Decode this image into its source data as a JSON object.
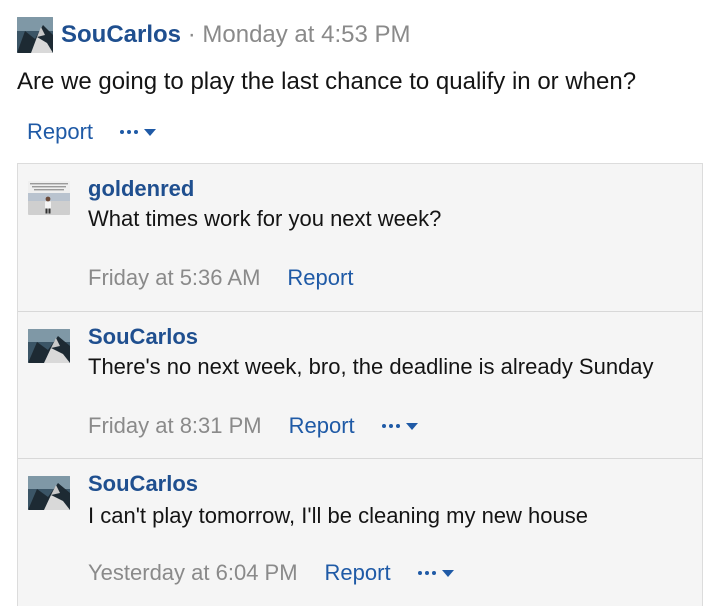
{
  "post": {
    "username": "SouCarlos",
    "separator": "·",
    "timestamp": "Monday at 4:53 PM",
    "body": "Are we going to play the last chance to qualify in or when?",
    "report_label": "Report",
    "avatar_icon": "anime-character-avatar"
  },
  "comments": [
    {
      "username": "goldenred",
      "text": "What times work for you next week?",
      "timestamp": "Friday at 5:36 AM",
      "report_label": "Report",
      "avatar_icon": "meme-photo-avatar",
      "has_more_menu": false
    },
    {
      "username": "SouCarlos",
      "text": "There's no next week, bro, the deadline is already Sunday",
      "timestamp": "Friday at 8:31 PM",
      "report_label": "Report",
      "avatar_icon": "anime-character-avatar",
      "has_more_menu": true
    },
    {
      "username": "SouCarlos",
      "text": "I can't play tomorrow, I'll be cleaning my new house",
      "timestamp": "Yesterday at 6:04 PM",
      "report_label": "Report",
      "avatar_icon": "anime-character-avatar",
      "has_more_menu": true
    }
  ],
  "colors": {
    "link": "#1f5aa6",
    "username": "#1f4f8f",
    "muted": "#8a8a8a",
    "comment_bg": "#f5f5f5"
  }
}
